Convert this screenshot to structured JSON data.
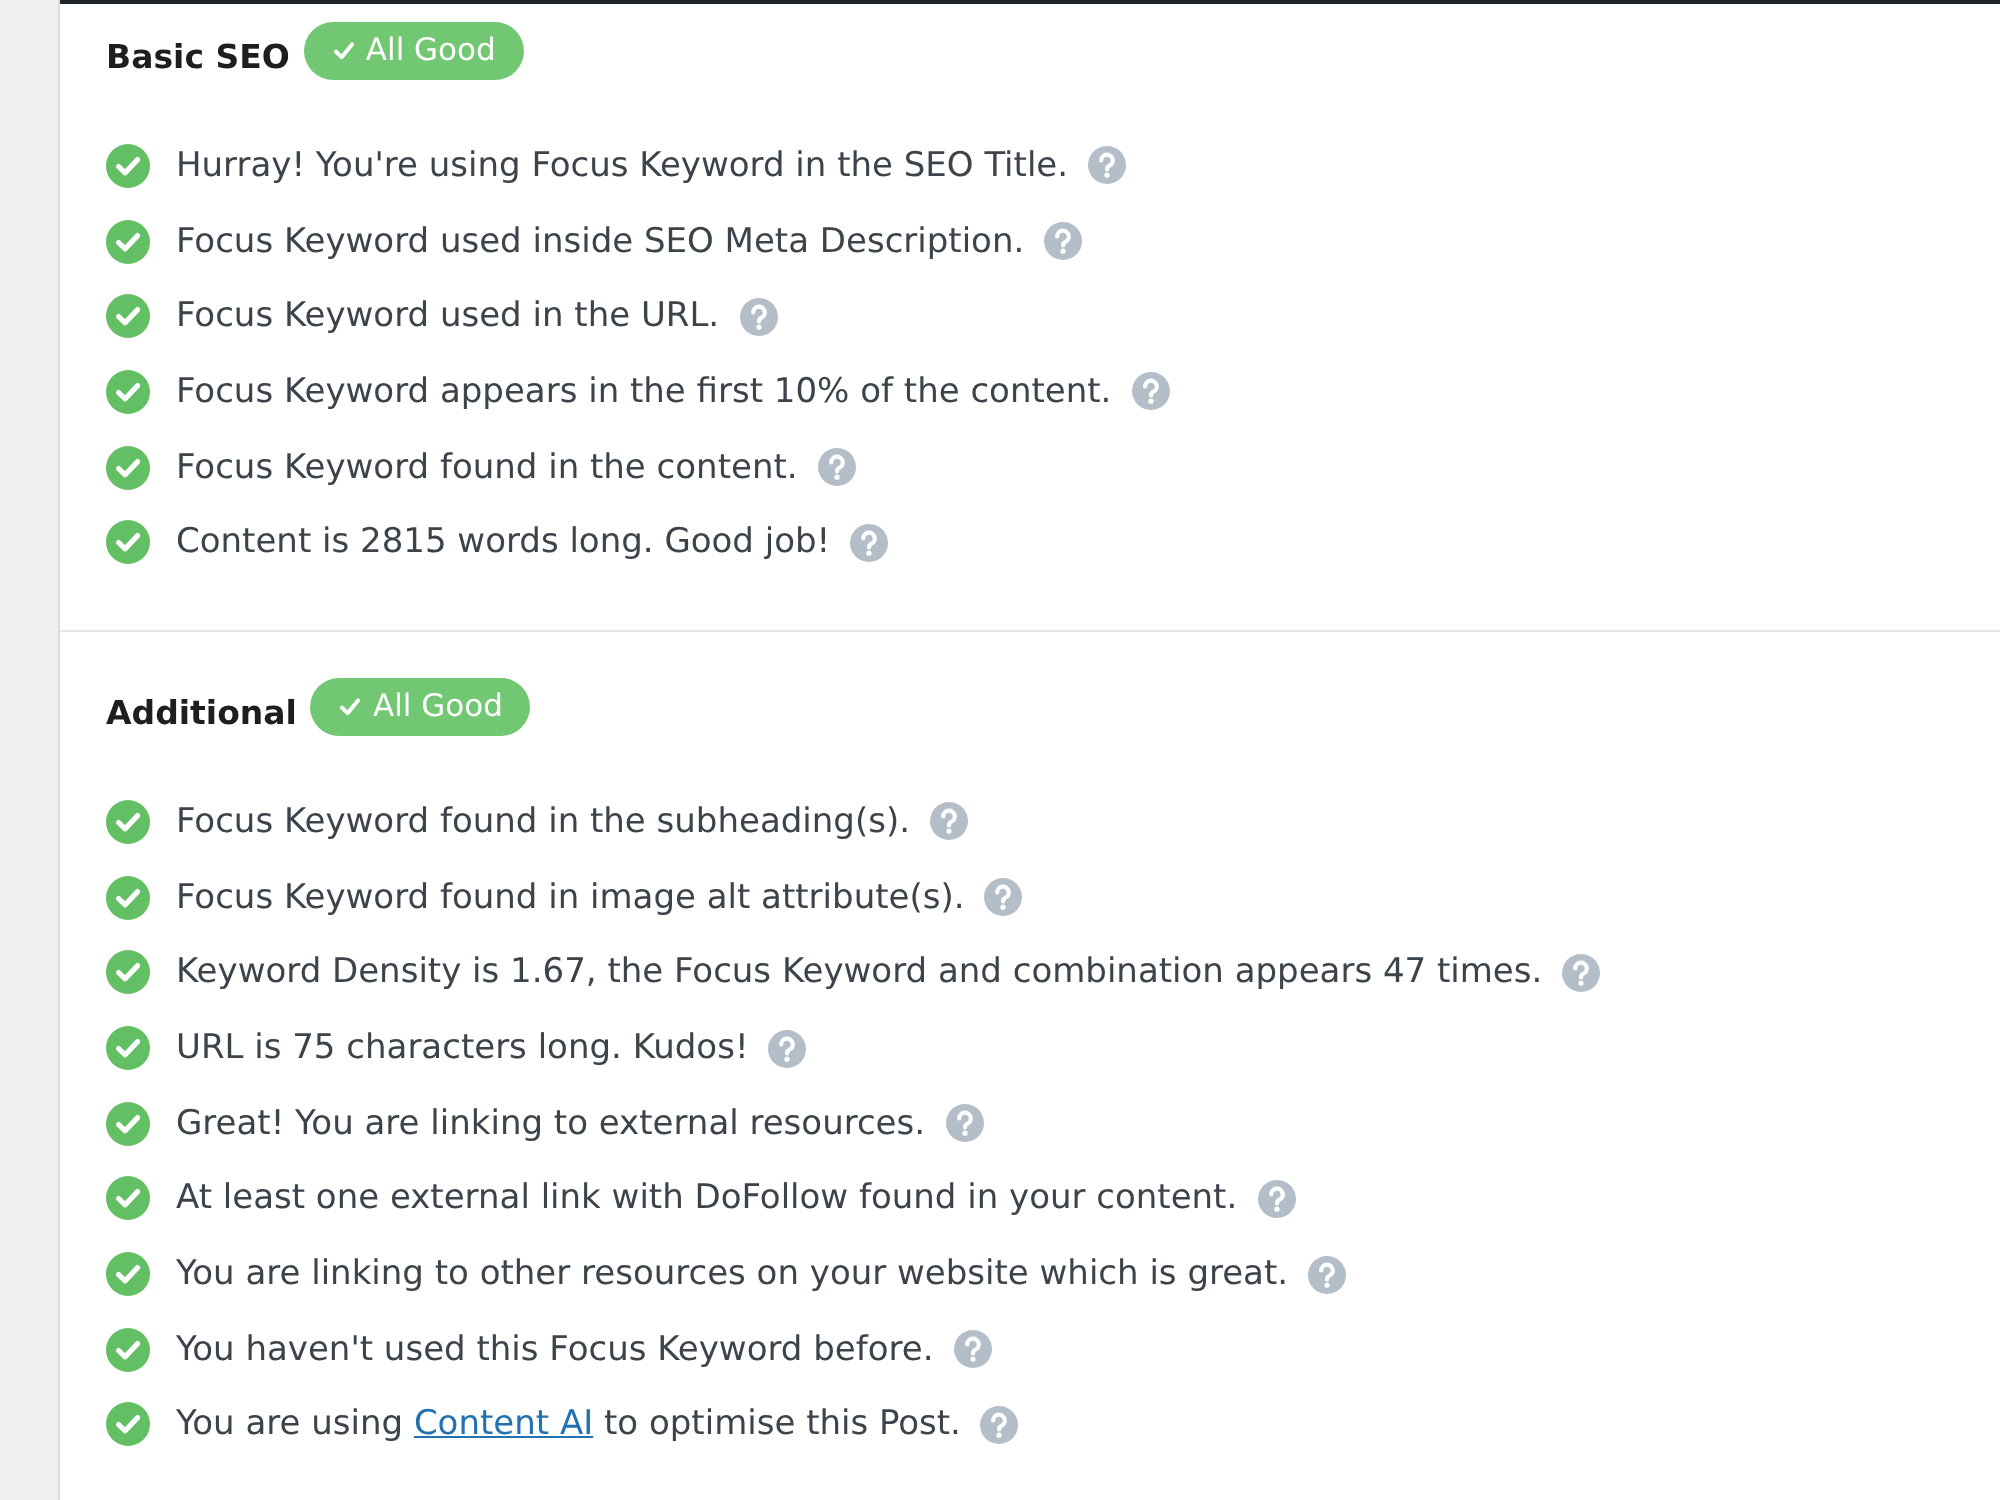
{
  "sections": [
    {
      "title": "Basic SEO",
      "badge": {
        "label": "All Good",
        "passed": true
      },
      "checks": [
        {
          "passed": true,
          "text": "Hurray! You're using Focus Keyword in the SEO Title."
        },
        {
          "passed": true,
          "text": "Focus Keyword used inside SEO Meta Description."
        },
        {
          "passed": true,
          "text": "Focus Keyword used in the URL."
        },
        {
          "passed": true,
          "text": "Focus Keyword appears in the first 10% of the content."
        },
        {
          "passed": true,
          "text": "Focus Keyword found in the content."
        },
        {
          "passed": true,
          "text": "Content is 2815 words long. Good job!"
        }
      ]
    },
    {
      "title": "Additional",
      "badge": {
        "label": "All Good",
        "passed": true
      },
      "checks": [
        {
          "passed": true,
          "text": "Focus Keyword found in the subheading(s)."
        },
        {
          "passed": true,
          "text": "Focus Keyword found in image alt attribute(s)."
        },
        {
          "passed": true,
          "text": "Keyword Density is 1.67, the Focus Keyword and combination appears 47 times."
        },
        {
          "passed": true,
          "text": "URL is 75 characters long. Kudos!"
        },
        {
          "passed": true,
          "text": "Great! You are linking to external resources."
        },
        {
          "passed": true,
          "text": "At least one external link with DoFollow found in your content."
        },
        {
          "passed": true,
          "text": "You are linking to other resources on your website which is great."
        },
        {
          "passed": true,
          "text": "You haven't used this Focus Keyword before."
        },
        {
          "passed": true,
          "text": "You are using ",
          "link": "Content AI",
          "text_after": " to optimise this Post."
        }
      ]
    }
  ]
}
